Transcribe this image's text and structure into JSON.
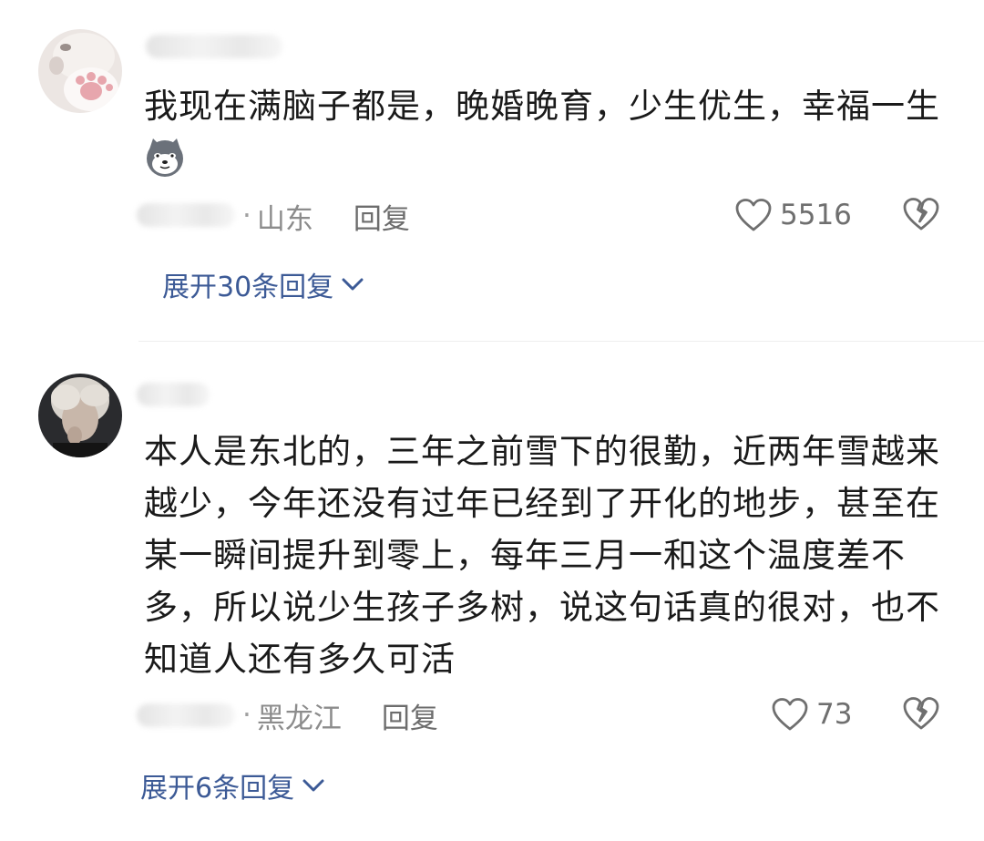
{
  "comments": [
    {
      "text": "我现在满脑子都是，晚婚晚育，少生优生，幸福一生",
      "emoji": "husky-emoji",
      "location": "山东",
      "reply_label": "回复",
      "likes": "5516",
      "expand_label": "展开30条回复"
    },
    {
      "text": "本人是东北的，三年之前雪下的很勤，近两年雪越来越少，今年还没有过年已经到了开化的地步，甚至在某一瞬间提升到零上，每年三月一和这个温度差不多，所以说少生孩子多树，说这句话真的很对，也不知道人还有多久可活",
      "location": "黑龙江",
      "reply_label": "回复",
      "likes": "73",
      "expand_label": "展开6条回复"
    }
  ],
  "colors": {
    "link": "#3c5a96",
    "meta": "#8c8c8c",
    "divider": "#eeeeee"
  },
  "separator": "·"
}
